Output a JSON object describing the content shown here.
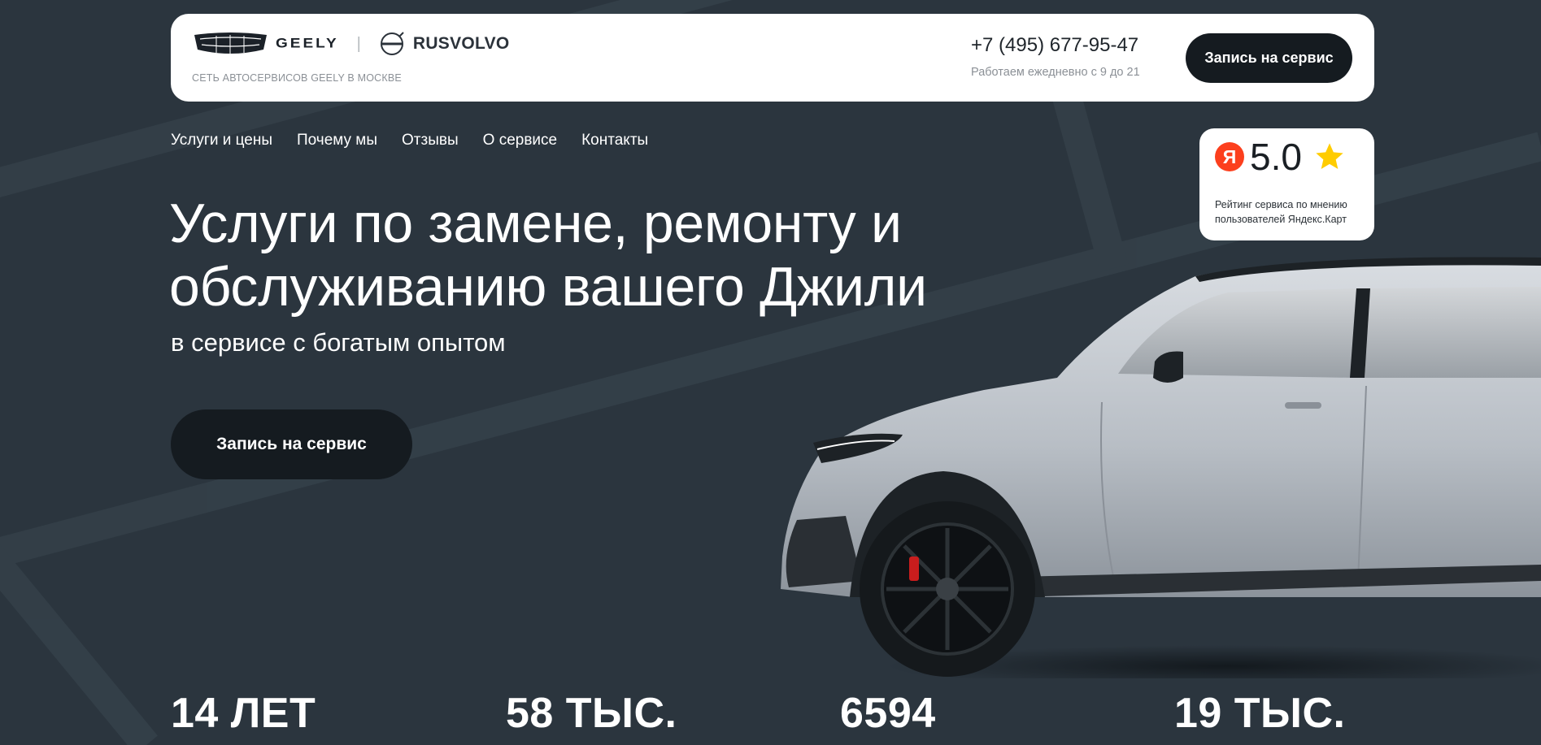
{
  "header": {
    "brand_primary": "GEELY",
    "brand_secondary": "RUSVOLVO",
    "tagline": "СЕТЬ АВТОСЕРВИСОВ GEELY В МОСКВЕ",
    "phone": "+7 (495) 677-95-47",
    "hours": "Работаем ежедневно с 9 до 21",
    "cta_label": "Запись на сервис"
  },
  "nav": {
    "items": [
      {
        "label": "Услуги и цены"
      },
      {
        "label": "Почему мы"
      },
      {
        "label": "Отзывы"
      },
      {
        "label": "О сервисе"
      },
      {
        "label": "Контакты"
      }
    ]
  },
  "rating": {
    "logo_letter": "Я",
    "score": "5.0",
    "caption": "Рейтинг сервиса по мнению пользователей Яндекс.Карт"
  },
  "hero": {
    "title_line1": "Услуги по замене, ремонту и",
    "title_line2": "обслуживанию вашего Джили",
    "subtitle": "в сервисе с богатым опытом",
    "cta_label": "Запись на сервис"
  },
  "stats": [
    {
      "value": "14 ЛЕТ"
    },
    {
      "value": "58 ТЫС."
    },
    {
      "value": "6594"
    },
    {
      "value": "19 ТЫС."
    }
  ],
  "colors": {
    "background": "#2b353e",
    "button_dark": "#151b20",
    "yandex_red": "#fc3f1d",
    "star_yellow": "#ffcc00"
  },
  "icons": {
    "geely_logo": "geely-emblem-icon",
    "volvo_logo": "volvo-emblem-icon",
    "yandex_logo": "yandex-logo-icon",
    "star": "star-icon"
  }
}
